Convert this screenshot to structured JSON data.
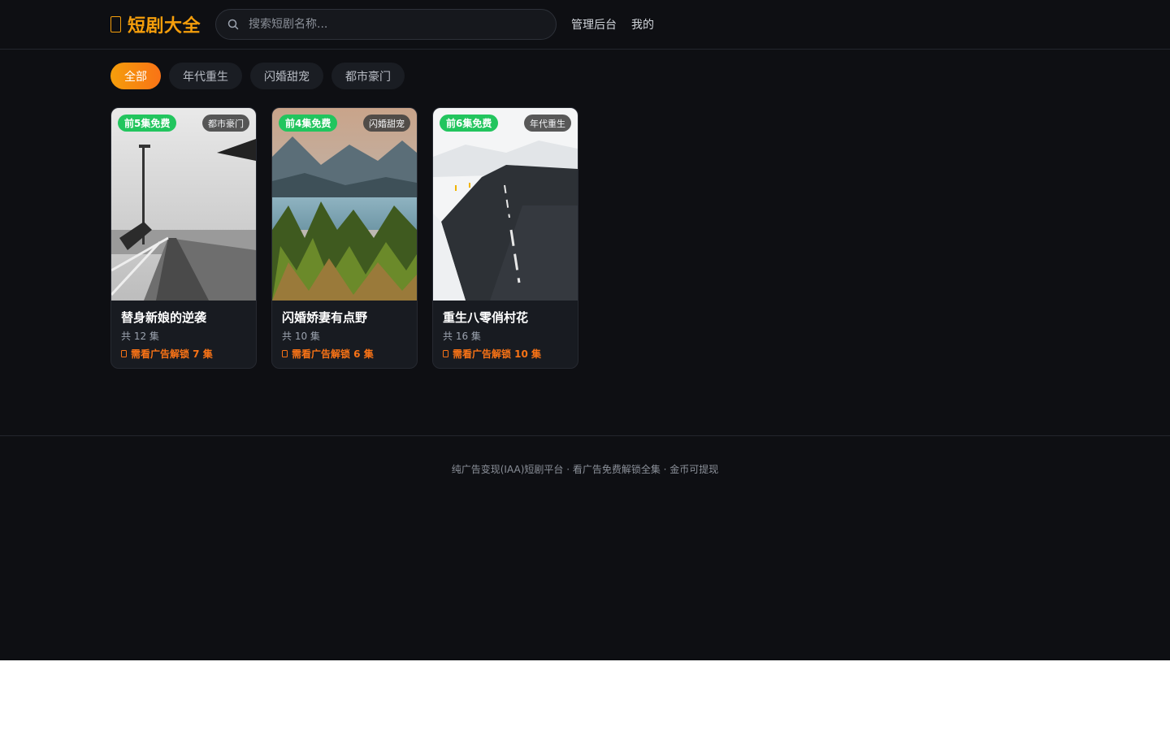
{
  "header": {
    "brand": "短剧大全",
    "search_placeholder": "搜索短剧名称...",
    "nav": [
      "管理后台",
      "我的"
    ]
  },
  "categories": [
    "全部",
    "年代重生",
    "闪婚甜宠",
    "都市豪门"
  ],
  "active_category": "全部",
  "dramas": [
    {
      "title": "替身新娘的逆袭",
      "free_badge": "前5集免费",
      "category": "都市豪门",
      "count": "共 12 集",
      "lock": "需看广告解锁 7 集"
    },
    {
      "title": "闪婚娇妻有点野",
      "free_badge": "前4集免费",
      "category": "闪婚甜宠",
      "count": "共 10 集",
      "lock": "需看广告解锁 6 集"
    },
    {
      "title": "重生八零俏村花",
      "free_badge": "前6集免费",
      "category": "年代重生",
      "count": "共 16 集",
      "lock": "需看广告解锁 10 集"
    }
  ],
  "footer": {
    "text": "纯广告变现(IAA)短剧平台 · 看广告免费解锁全集 · 金币可提现"
  },
  "colors": {
    "brand": "#f59e0b",
    "accent": "#f97316",
    "free": "#22c55e",
    "background": "#0e0f13"
  }
}
